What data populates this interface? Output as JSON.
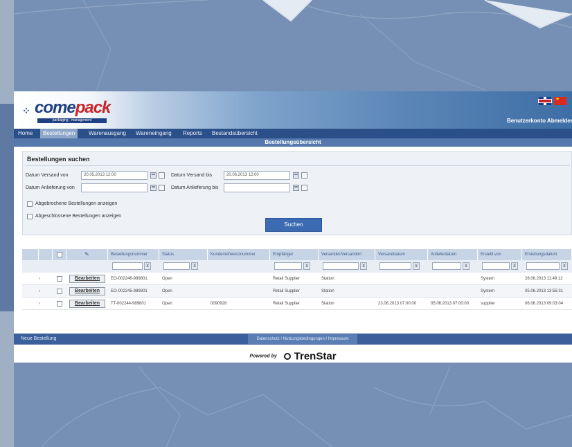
{
  "colors": {
    "background": "#6f88ad",
    "nav": "#2b4f88",
    "titlebar": "#5579ad",
    "accent_red": "#c8242b",
    "button_blue": "#3d6bb3"
  },
  "header": {
    "logo_text_1": "come",
    "logo_text_2": "pack",
    "logo_tagline": "packaging · management",
    "user_links": "Benutzerkonto  Abmelden | Login"
  },
  "nav": {
    "items": [
      {
        "label": "Home",
        "active": false
      },
      {
        "label": "Bestellungen",
        "active": true
      },
      {
        "label": "Warenausgang",
        "active": false
      },
      {
        "label": "Wareneingang",
        "active": false
      },
      {
        "label": "Reports",
        "active": false
      },
      {
        "label": "Bestandsübersicht",
        "active": false
      }
    ],
    "page_title": "Bestellungsübersicht"
  },
  "search": {
    "title": "Bestellungen suchen",
    "date_sent_from_label": "Datum Versand von",
    "date_sent_from_value": "20.05.2013 12:00",
    "date_sent_to_label": "Datum Versand bis",
    "date_sent_to_value": "20.06.2013 12:00",
    "date_delivery_from_label": "Datum Anlieferung von",
    "date_delivery_to_label": "Datum Anlieferung bis",
    "show_deleted_label": "Abgebrochene Bestellungen anzeigen",
    "show_closed_label": "Abgeschlossene Bestellungen anzeigen",
    "search_button": "Suchen"
  },
  "table": {
    "columns": [
      "",
      "",
      "Bestellungsnummer",
      "Status",
      "Kundenreferenznummer",
      "Empfänger",
      "Versender/Versandort",
      "Versanddatum",
      "Anlieferdatum",
      "Erstellt von",
      "Erstellungsdatum"
    ],
    "filter_icon": "filter-icon",
    "edit_label": "Bearbeiten",
    "rows": [
      {
        "order_no": "EO-002246-989801",
        "status": "Open",
        "customer_ref": "",
        "recipient": "Retail Supplier",
        "sender": "Station",
        "ship_date": "",
        "delivery_date": "",
        "created_by": "System",
        "created_at": "28.06.2013 11:49:12"
      },
      {
        "order_no": "EO-002245-989801",
        "status": "Open",
        "customer_ref": "",
        "recipient": "Retail Supplier",
        "sender": "Station",
        "ship_date": "",
        "delivery_date": "",
        "created_by": "System",
        "created_at": "05.06.2013 13:55:31"
      },
      {
        "order_no": "TT-002244-989801",
        "status": "Open",
        "customer_ref": "0090928",
        "recipient": "Retail Supplier",
        "sender": "Station",
        "ship_date": "23.06.2013 07:00:00",
        "delivery_date": "05.06.2013 07:00:00",
        "created_by": "supplier",
        "created_at": "06.06.2013 09:03:04"
      }
    ]
  },
  "footer": {
    "new_order": "Neue Bestellung",
    "links": "Datenschutz / Nutzungsbedingungen / Impressum",
    "powered_by": "Powered by",
    "brand": "TrenStar"
  }
}
